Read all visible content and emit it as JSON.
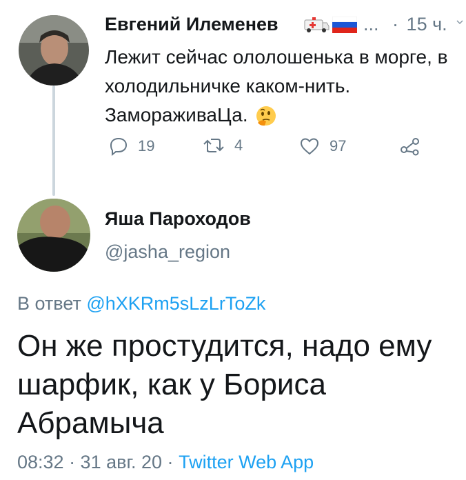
{
  "parent_tweet": {
    "author_name": "Евгений Илеменев",
    "ellipsis": "...",
    "separator": "·",
    "time_ago": "15 ч.",
    "text": "Лежит сейчас ололошенька в морге, в холодильничке каком-нить. ЗаморaживаЦа.",
    "emoji": "thinking-face",
    "actions": {
      "replies": "19",
      "retweets": "4",
      "likes": "97"
    }
  },
  "reply_tweet": {
    "author_name": "Яша Пароходов",
    "handle": "@jasha_region",
    "reply_prefix": "В ответ",
    "reply_handle": "@hXKRm5sLzLrToZk",
    "text": "Он же простудится, надо ему шарфик, как у Бориса Абрамыча",
    "timestamp": "08:32 · 31 авг. 20 ·",
    "source": "Twitter Web App"
  },
  "colors": {
    "link": "#1da1f2",
    "muted": "#657786",
    "text": "#14171a",
    "thread_line": "#ccd6dd"
  }
}
